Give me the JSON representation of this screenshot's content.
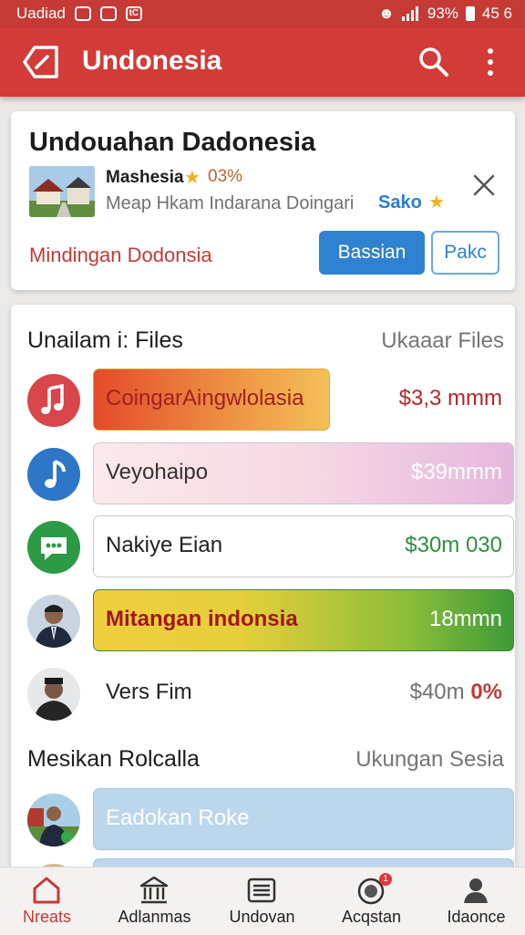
{
  "status": {
    "carrier": "Uadiad",
    "battery": "93%",
    "time": "45 6"
  },
  "appbar": {
    "title": "Undonesia"
  },
  "promo": {
    "heading": "Undouahan Dadonesia",
    "name": "Mashesia",
    "rating": "03%",
    "description": "Meap Hkam Indarana Doingari",
    "tag": "Sako",
    "link": "Mindingan Dodonsia",
    "primary_button": "Bassian",
    "secondary_button": "Pakc"
  },
  "files": {
    "title": "Unailam i: Files",
    "link": "Ukaaar Files",
    "rows": [
      {
        "label": "CoingarAingwlolasia",
        "value": "$3,3 mmm"
      },
      {
        "label": "Veyohaipo",
        "value": "$39mmm"
      },
      {
        "label": "Nakiye Eian",
        "value": "$30m 030"
      },
      {
        "label": "Mitangan indonsia",
        "value": "18mmn"
      },
      {
        "label": "Vers Fim",
        "value": "$40m",
        "value_extra": "0%"
      }
    ]
  },
  "second": {
    "title": "Mesikan Rolcalla",
    "link": "Ukungan Sesia",
    "rows": [
      {
        "label": "Eadokan Roke"
      }
    ]
  },
  "nav": [
    {
      "label": "Nreats",
      "icon": "home-icon"
    },
    {
      "label": "Adlanmas",
      "icon": "bank-icon"
    },
    {
      "label": "Undovan",
      "icon": "list-icon"
    },
    {
      "label": "Acqstan",
      "icon": "notification-icon",
      "badge": "1"
    },
    {
      "label": "Idaonce",
      "icon": "profile-icon"
    }
  ],
  "colors": {
    "primary": "#d23b37",
    "accent": "#2f82cf"
  }
}
